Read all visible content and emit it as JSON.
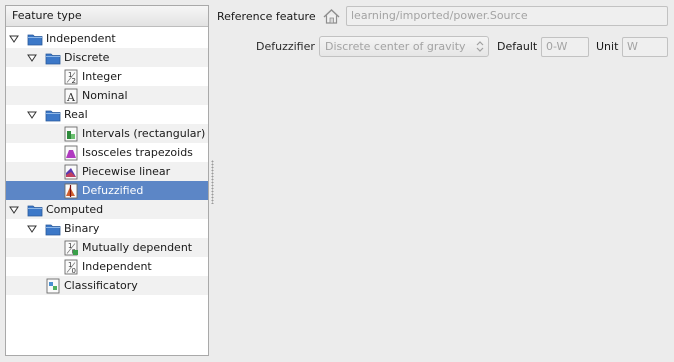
{
  "tree": {
    "header": "Feature type",
    "nodes": [
      {
        "label": "Independent",
        "level": 0,
        "expanded": true,
        "icon": "folder-icon"
      },
      {
        "label": "Discrete",
        "level": 1,
        "expanded": true,
        "icon": "folder-icon"
      },
      {
        "label": "Integer",
        "level": 2,
        "icon": "integer-icon",
        "glyph": "1/2"
      },
      {
        "label": "Nominal",
        "level": 2,
        "icon": "nominal-icon",
        "glyph": "A"
      },
      {
        "label": "Real",
        "level": 1,
        "expanded": true,
        "icon": "folder-icon"
      },
      {
        "label": "Intervals (rectangular)",
        "level": 2,
        "icon": "rectangular-intervals-icon"
      },
      {
        "label": "Isosceles trapezoids",
        "level": 2,
        "icon": "trapezoid-icon"
      },
      {
        "label": "Piecewise linear",
        "level": 2,
        "icon": "piecewise-linear-icon"
      },
      {
        "label": "Defuzzified",
        "level": 2,
        "icon": "defuzzified-icon",
        "selected": true
      },
      {
        "label": "Computed",
        "level": 0,
        "expanded": true,
        "icon": "folder-icon"
      },
      {
        "label": "Binary",
        "level": 1,
        "expanded": true,
        "icon": "folder-icon"
      },
      {
        "label": "Mutually dependent",
        "level": 2,
        "icon": "mutually-dependent-icon",
        "glyph": "1/0"
      },
      {
        "label": "Independent",
        "level": 2,
        "icon": "binary-independent-icon",
        "glyph": "1/0"
      },
      {
        "label": "Classificatory",
        "level": 1,
        "icon": "classificatory-icon"
      }
    ]
  },
  "form": {
    "reference_label": "Reference feature",
    "reference_value": "learning/imported/power.Source",
    "defuzzifier_label": "Defuzzifier",
    "defuzzifier_value": "Discrete center of gravity",
    "default_label": "Default",
    "default_value": "0-W",
    "unit_label": "Unit",
    "unit_value": "W"
  },
  "colors": {
    "selection": "#5c86c6",
    "folder": "#3c78c8",
    "disabled_text": "#a3a3a3"
  }
}
